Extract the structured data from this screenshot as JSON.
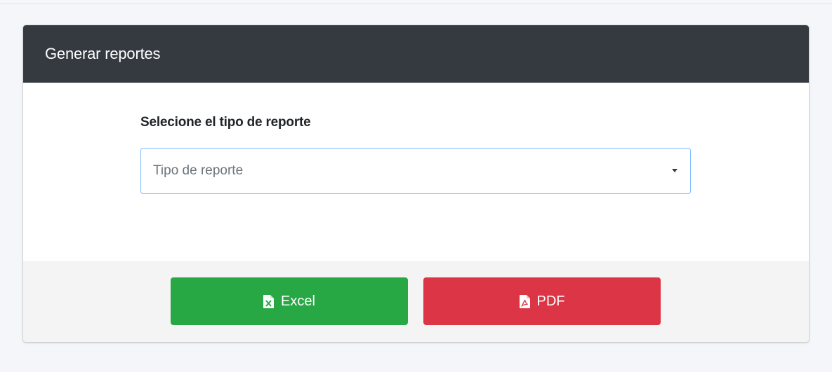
{
  "card": {
    "title": "Generar reportes"
  },
  "form": {
    "label": "Selecione el tipo de reporte",
    "select_placeholder": "Tipo de reporte"
  },
  "actions": {
    "excel_label": "Excel",
    "excel_icon": "file-excel-icon",
    "pdf_label": "PDF",
    "pdf_icon": "file-pdf-icon"
  },
  "colors": {
    "header_bg": "#343a40",
    "excel_button": "#28a745",
    "pdf_button": "#dc3545",
    "select_border": "#80bdff"
  }
}
